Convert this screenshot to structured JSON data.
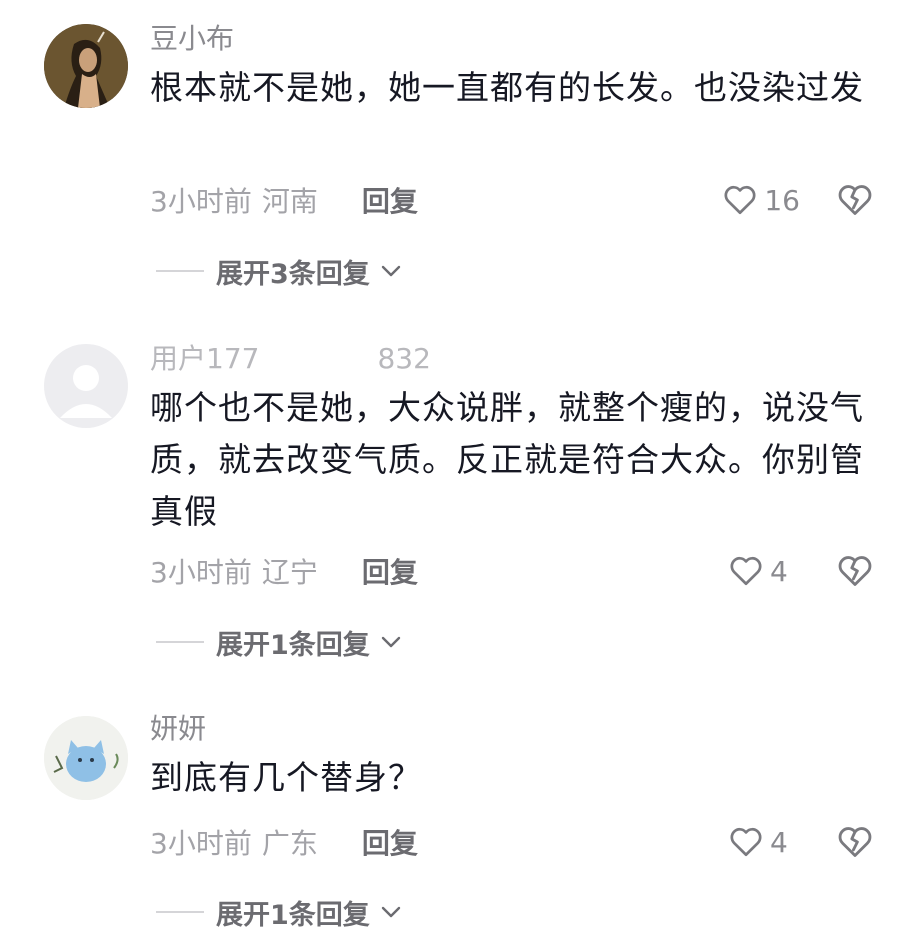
{
  "comments": [
    {
      "username": "豆小布",
      "text": "根本就不是她，她一直都有的长发。也没染过发",
      "time": "3小时前",
      "location": "河南",
      "reply_label": "回复",
      "likes": "16",
      "expand_label": "展开3条回复"
    },
    {
      "username": "用户177",
      "username_tail": "832",
      "text": "哪个也不是她，大众说胖，就整个瘦的，说没气质，就去改变气质。反正就是符合大众。你别管真假",
      "time": "3小时前",
      "location": "辽宁",
      "reply_label": "回复",
      "likes": "4",
      "expand_label": "展开1条回复"
    },
    {
      "username": "妍妍",
      "text": "到底有几个替身？",
      "time": "3小时前",
      "location": "广东",
      "reply_label": "回复",
      "likes": "4",
      "expand_label": "展开1条回复"
    }
  ],
  "icons": {
    "like": "heart-outline-icon",
    "dislike": "broken-heart-icon",
    "expand": "chevron-down-icon"
  },
  "colors": {
    "text": "#161823",
    "username": "#8a8a8f",
    "meta": "#a3a3a8",
    "reply": "#6b6b70"
  }
}
